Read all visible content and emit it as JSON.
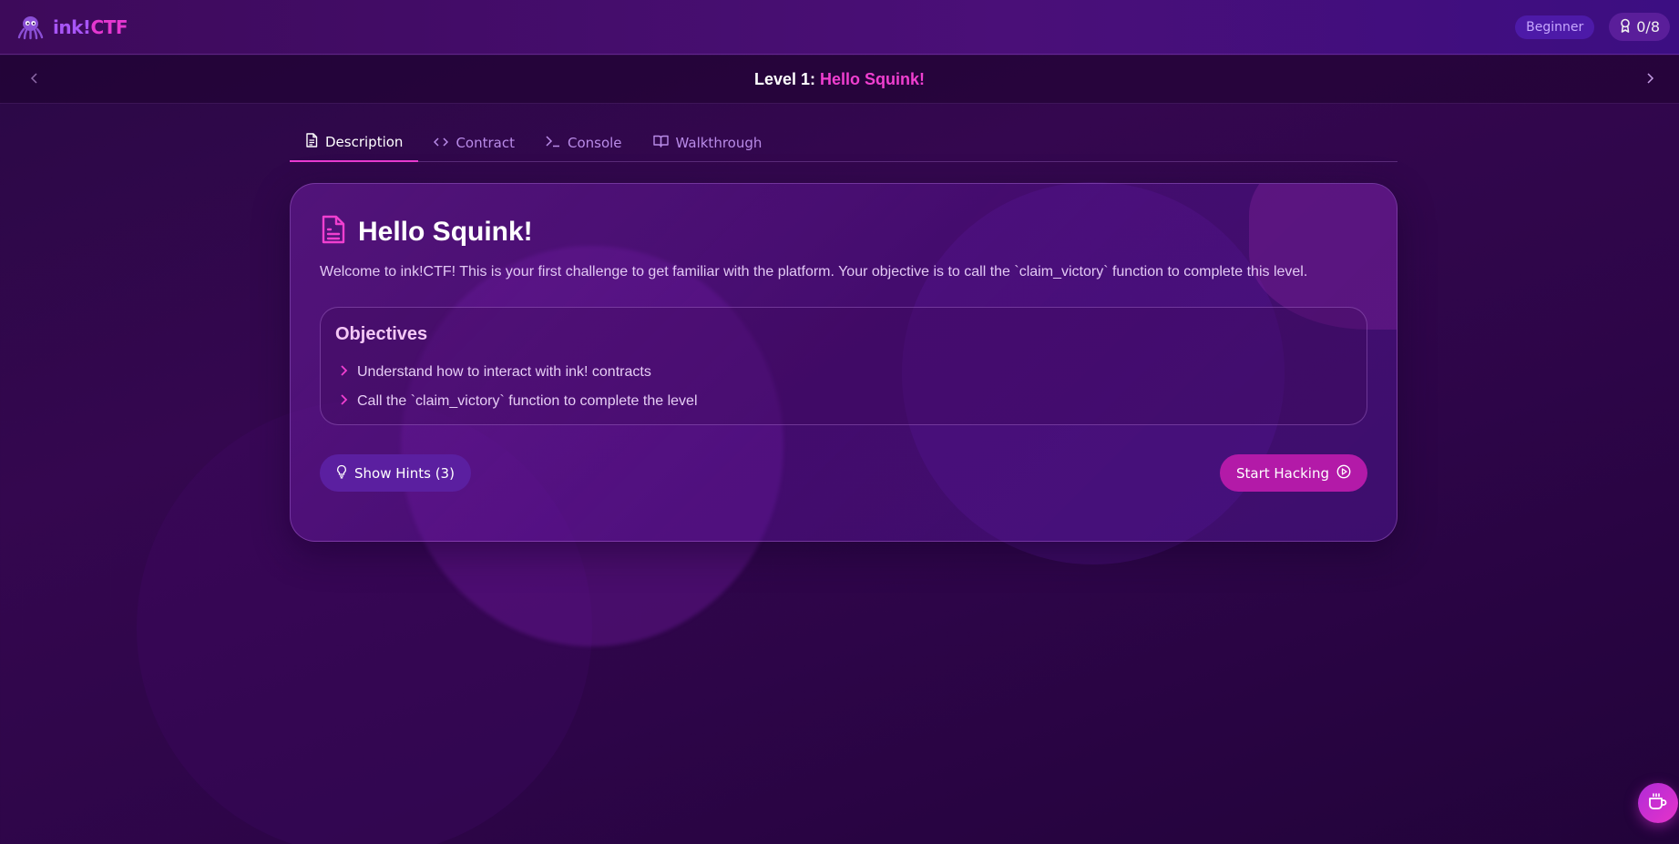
{
  "app": {
    "brand_ink": "ink!",
    "brand_ctf": "CTF",
    "logo_icon": "octopus-icon"
  },
  "header": {
    "difficulty_badge": "Beginner",
    "progress": "0/8",
    "progress_icon": "award-icon"
  },
  "level": {
    "prefix": "Level 1:",
    "name": "Hello Squink!",
    "prev_icon": "chevron-left-icon",
    "next_icon": "chevron-right-icon"
  },
  "tabs": [
    {
      "label": "Description",
      "icon": "document-icon",
      "active": true
    },
    {
      "label": "Contract",
      "icon": "code-icon",
      "active": false
    },
    {
      "label": "Console",
      "icon": "terminal-icon",
      "active": false
    },
    {
      "label": "Walkthrough",
      "icon": "book-icon",
      "active": false
    }
  ],
  "card": {
    "title": "Hello Squink!",
    "description": "Welcome to ink!CTF! This is your first challenge to get familiar with the platform. Your objective is to call the `claim_victory` function to complete this level.",
    "objectives_title": "Objectives",
    "objectives": [
      "Understand how to interact with ink! contracts",
      "Call the `claim_victory` function to complete the level"
    ],
    "hints_button": "Show Hints (3)",
    "start_button": "Start Hacking"
  },
  "colors": {
    "accent": "#e93bd2",
    "brand_purple": "#a855f7",
    "background": "#2d0548"
  }
}
